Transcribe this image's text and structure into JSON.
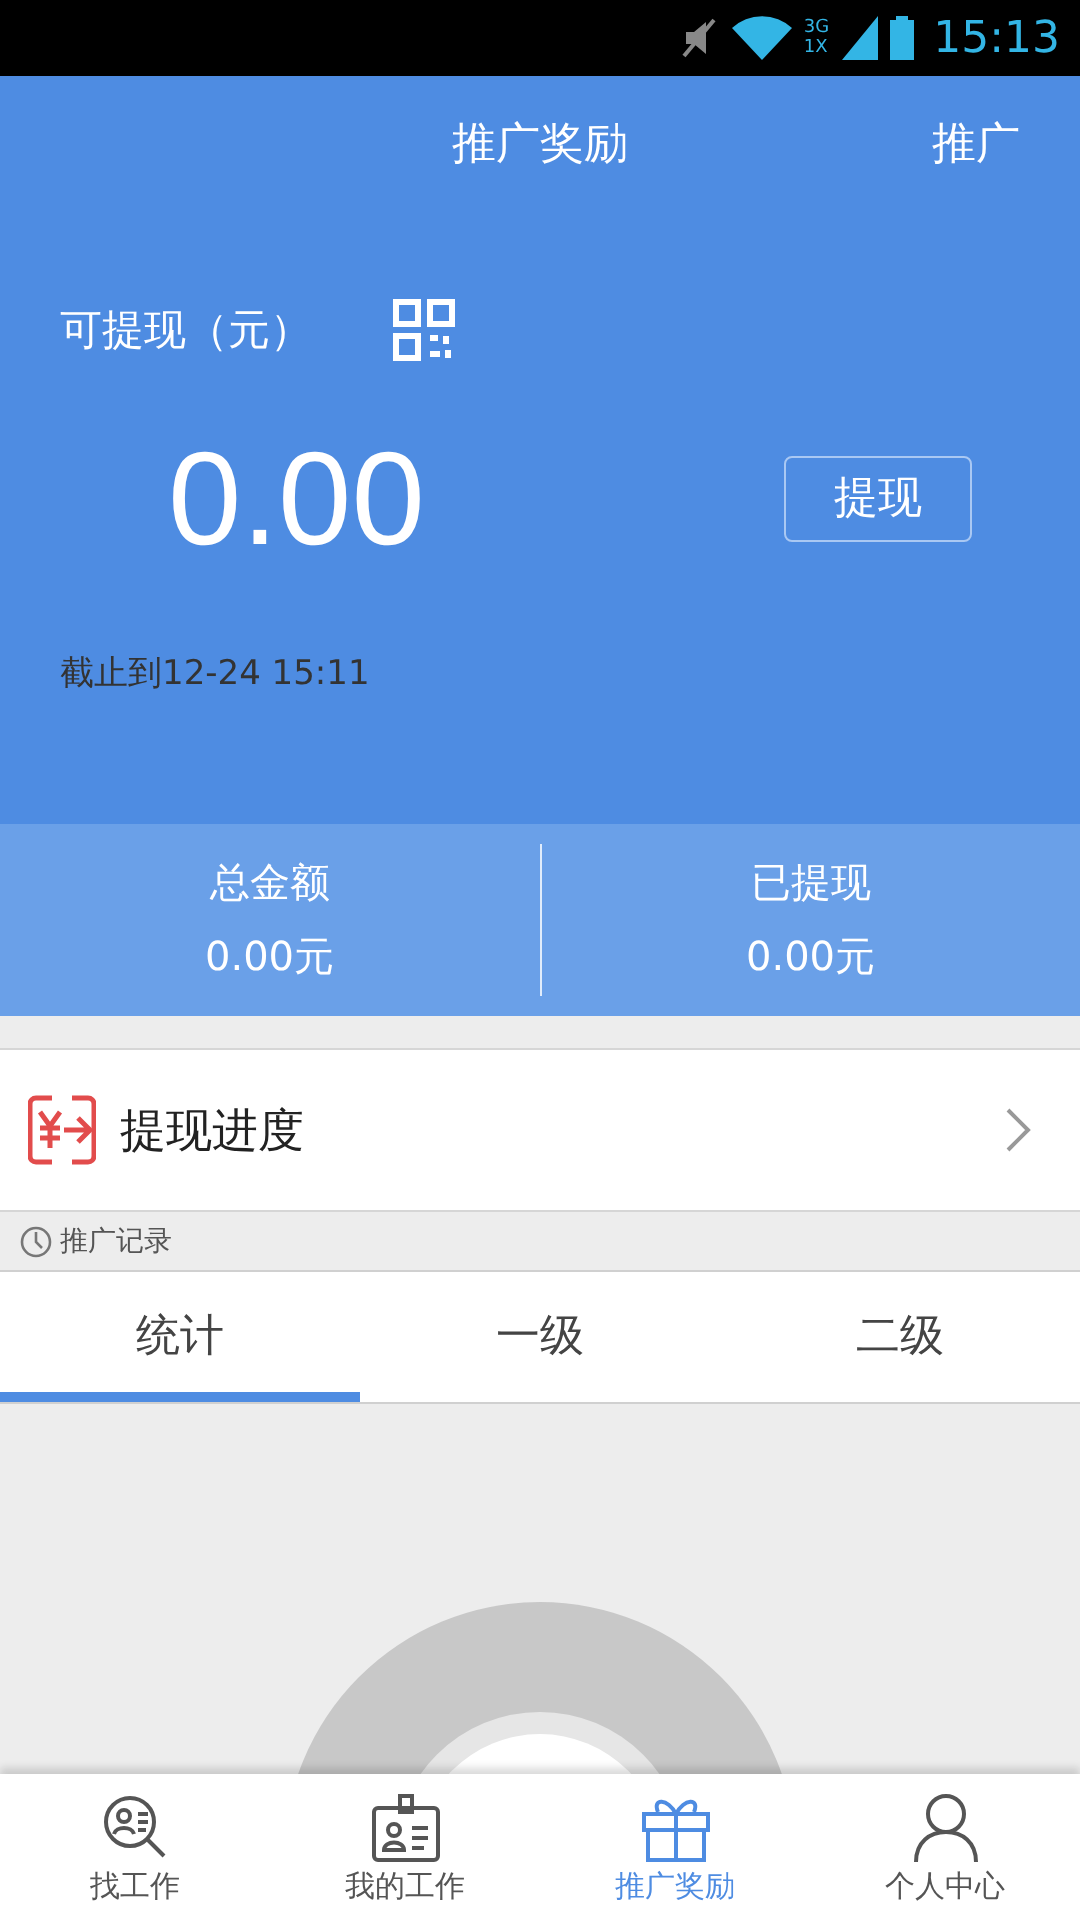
{
  "status_bar": {
    "network_labels": [
      "3G",
      "1X"
    ],
    "time": "15:13"
  },
  "header": {
    "title": "推广奖励",
    "action": "推广"
  },
  "balance": {
    "label": "可提现（元）",
    "amount": "0.00",
    "button": "提现",
    "as_of": "截止到12-24 15:11"
  },
  "summary": [
    {
      "label": "总金额",
      "value": "0.00元"
    },
    {
      "label": "已提现",
      "value": "0.00元"
    }
  ],
  "progress_row": {
    "label": "提现进度"
  },
  "records_header": {
    "label": "推广记录"
  },
  "tabs": [
    {
      "label": "统计",
      "selected": true
    },
    {
      "label": "一级",
      "selected": false
    },
    {
      "label": "二级",
      "selected": false
    }
  ],
  "bottom_nav": [
    {
      "label": "找工作",
      "kind": "search",
      "selected": false
    },
    {
      "label": "我的工作",
      "kind": "badge",
      "selected": false
    },
    {
      "label": "推广奖励",
      "kind": "gift",
      "selected": true
    },
    {
      "label": "个人中心",
      "kind": "person",
      "selected": false
    }
  ]
}
